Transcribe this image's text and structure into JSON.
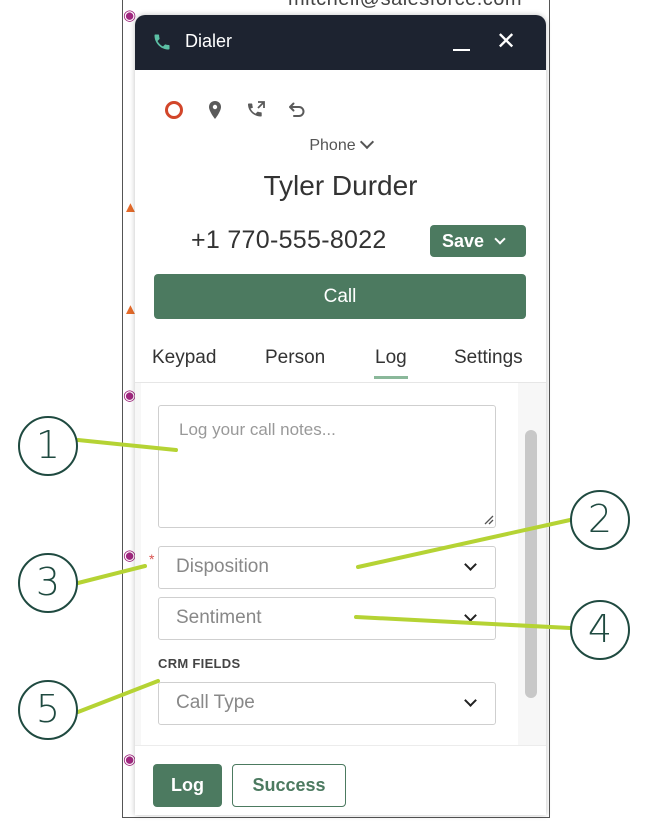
{
  "background": {
    "email_fragment": "mitchell@salesforce.com"
  },
  "dialer": {
    "title": "Dialer",
    "phone_type_label": "Phone",
    "contact_name": "Tyler Durder",
    "contact_number": "+1 770-555-8022",
    "save_label": "Save",
    "call_label": "Call",
    "tabs": [
      {
        "label": "Keypad"
      },
      {
        "label": "Person"
      },
      {
        "label": "Log",
        "active": true
      },
      {
        "label": "Settings"
      }
    ],
    "notes_placeholder": "Log your call notes...",
    "disposition_placeholder": "Disposition",
    "sentiment_placeholder": "Sentiment",
    "crm_fields_label": "CRM FIELDS",
    "call_type_placeholder": "Call Type",
    "log_label": "Log",
    "success_label": "Success"
  },
  "callouts": [
    "1",
    "2",
    "3",
    "4",
    "5"
  ],
  "colors": {
    "brand_green": "#4c7a60",
    "titlebar": "#1d2330",
    "callout_line": "#b5d334",
    "callout_ring": "#1f4a40",
    "required": "#d9534f"
  }
}
